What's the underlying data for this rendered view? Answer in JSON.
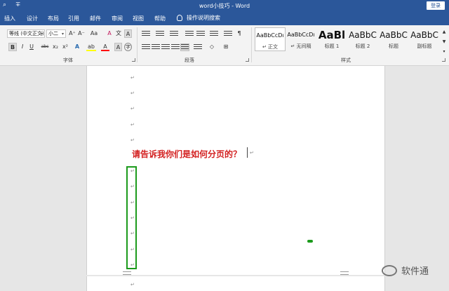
{
  "window": {
    "title": "word小技巧 - Word",
    "login_label": "登录",
    "quick_access": [
      "⌕",
      "∓"
    ]
  },
  "tabs": [
    "插入",
    "设计",
    "布局",
    "引用",
    "邮件",
    "审阅",
    "视图",
    "帮助"
  ],
  "tell_me": "操作说明搜索",
  "ribbon": {
    "font_group_label": "字体",
    "paragraph_group_label": "段落",
    "styles_group_label": "样式",
    "font_name": "等线 (中文正文)",
    "font_size": "小二",
    "font_buttons": {
      "grow": "A⁺",
      "shrink": "A⁻",
      "case": "Aa",
      "clear": "A",
      "pinyin": "文",
      "border": "A",
      "bold": "B",
      "italic": "I",
      "underline": "U",
      "strike": "abc",
      "subscript": "x₂",
      "superscript": "x²",
      "effects": "A",
      "highlight": "ab",
      "font_color": "A",
      "shading": "A",
      "circled": "字"
    },
    "styles": [
      {
        "sample": "AaBbCcDı",
        "name": "↵ 正文"
      },
      {
        "sample": "AaBbCcDı",
        "name": "↵ 无间隔"
      },
      {
        "sample": "AaBl",
        "name": "标题 1"
      },
      {
        "sample": "AaBbC",
        "name": "标题 2"
      },
      {
        "sample": "AaBbC",
        "name": "标题"
      },
      {
        "sample": "AaBbC",
        "name": "副标题"
      }
    ],
    "colors": {
      "highlight": "#ffff00",
      "font_color": "#ff0000",
      "effects": "#2b6cb0"
    }
  },
  "document": {
    "paragraph_mark": "↵",
    "heading_text": "请告诉我你们是如何分页的？",
    "heading_color": "#d32020",
    "annotation_color": "#1c9a1c"
  },
  "watermark": {
    "text": "软件通"
  }
}
